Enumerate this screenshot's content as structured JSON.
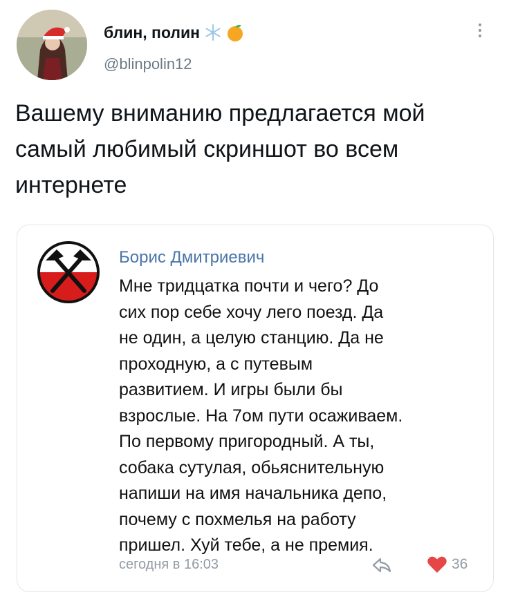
{
  "tweet": {
    "author": {
      "name": "блин, полин",
      "handle": "@blinpolin12",
      "badge_icons": [
        "snowflake-icon",
        "tangerine-icon"
      ]
    },
    "text": "Вашему вниманию предлагается мой самый любимый скриншот во всем интернете",
    "more_icon": "more-vertical-icon"
  },
  "embedded_comment": {
    "author": "Борис Дмитриевич",
    "text": "Мне тридцатка почти и чего? До\nсих пор себе хочу лего поезд. Да\nне один, а целую станцию. Да не\nпроходную, а с путевым\nразвитием. И игры были бы\nвзрослые. На 7ом пути осаживаем.\nПо первому пригородный. А ты,\nсобака сутулая, обьяснительную\nнапиши на имя начальника депо,\nпочему с похмелья на работу\nпришел. Хуй тебе, а не премия.",
    "timestamp": "сегодня в 16:03",
    "likes": "36",
    "icons": [
      "crossed-hammers-icon",
      "share-icon",
      "heart-icon"
    ],
    "colors": {
      "name": "#4a76a8",
      "meta": "#939ba5",
      "heart": "#e64646"
    }
  }
}
